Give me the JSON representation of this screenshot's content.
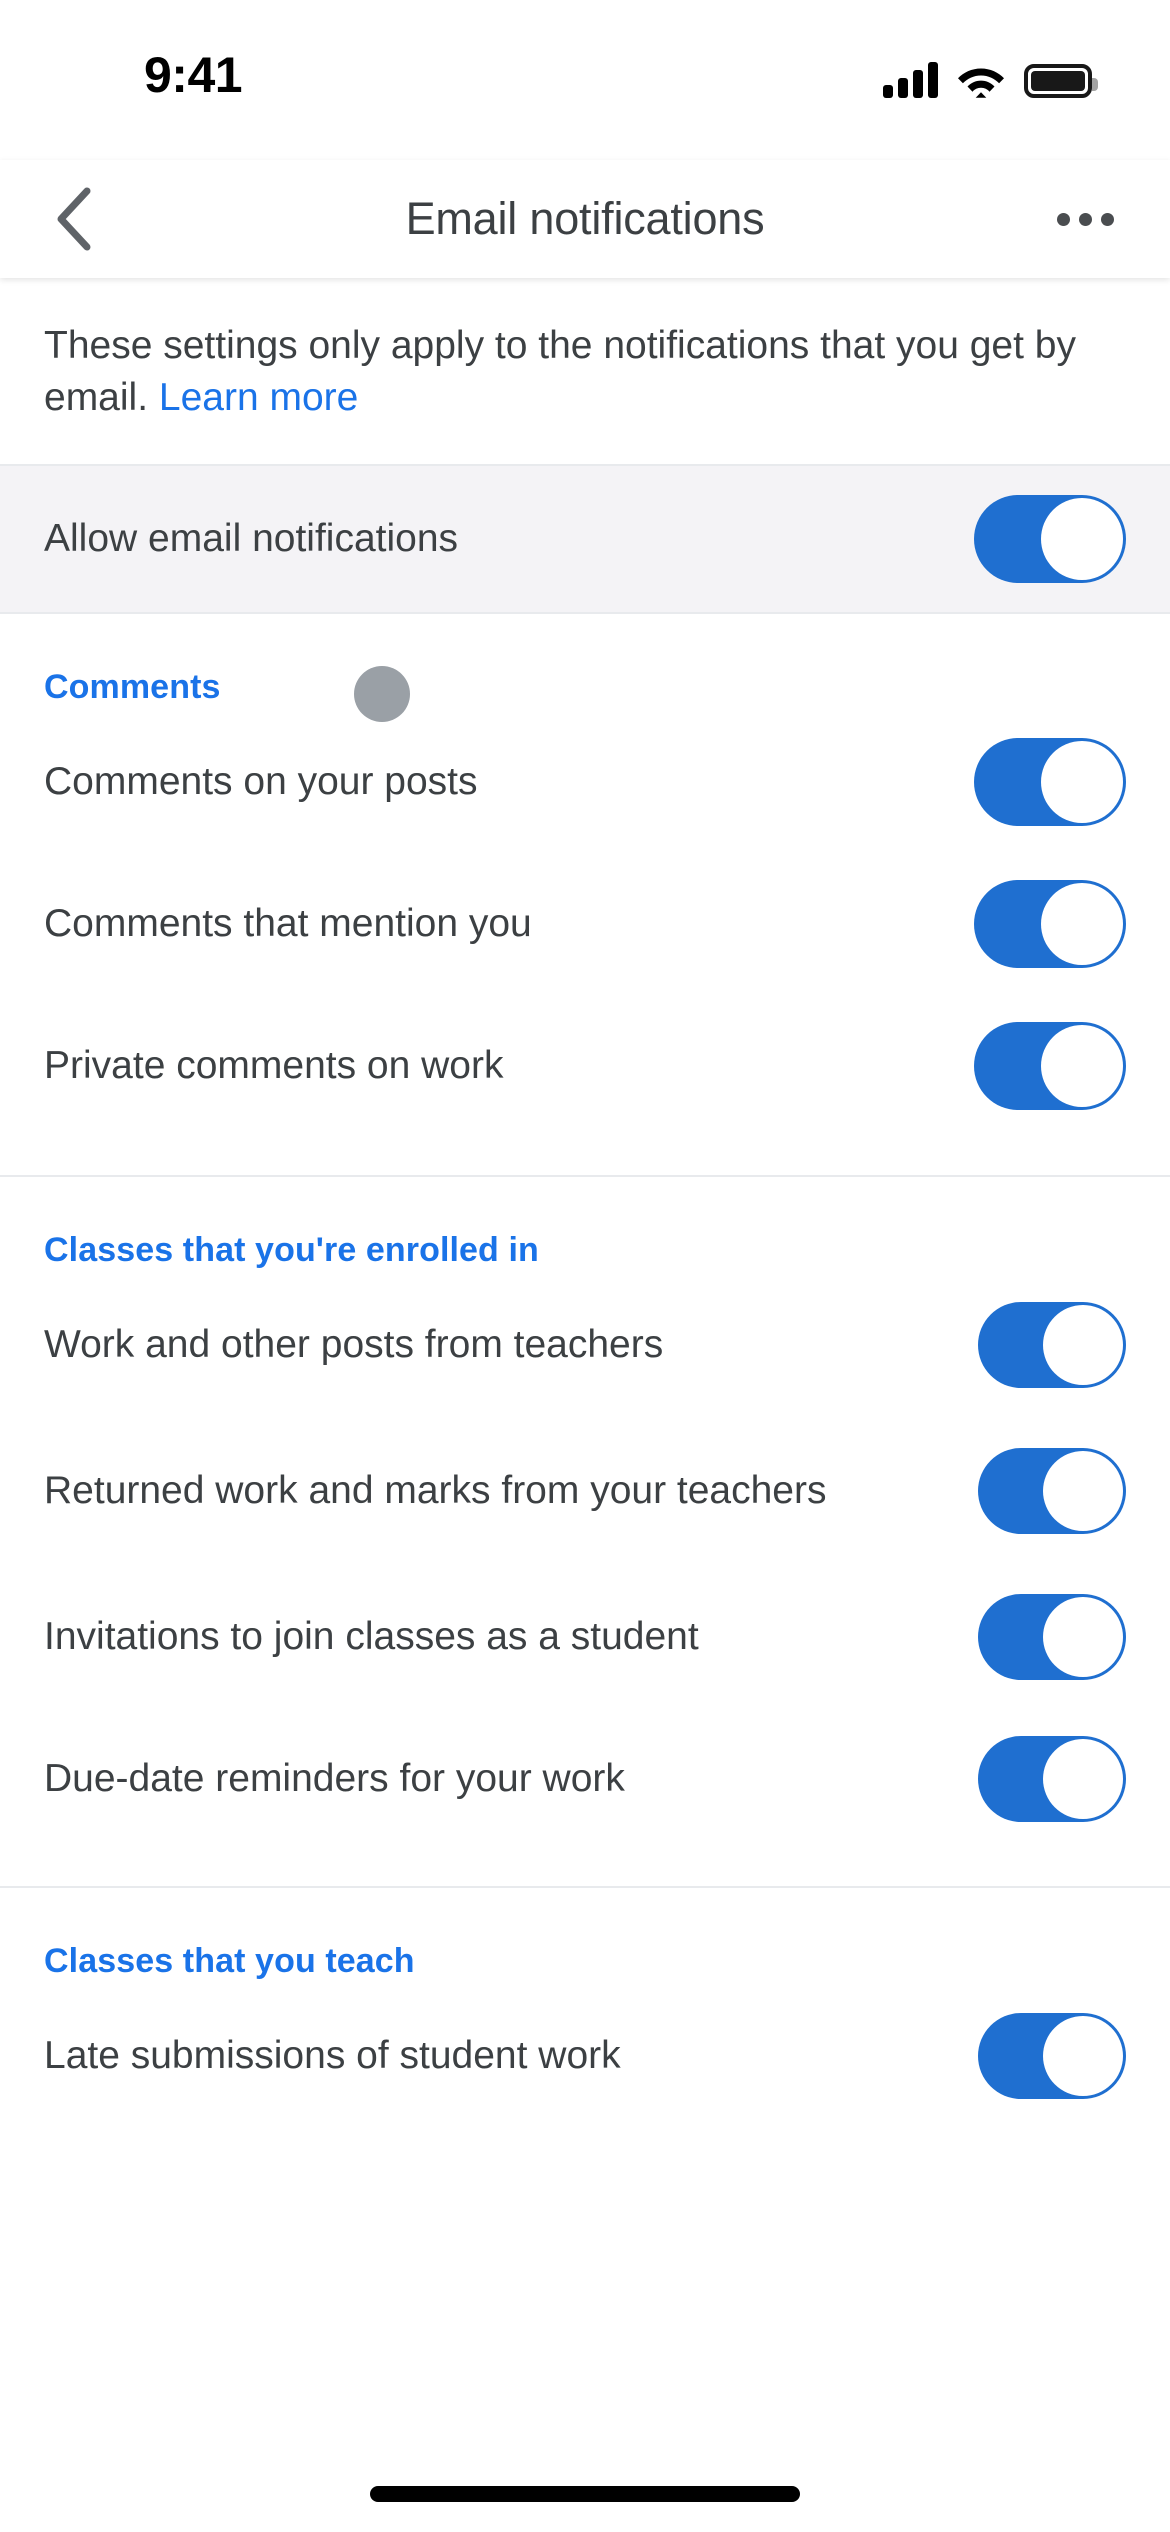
{
  "status_bar": {
    "time": "9:41",
    "cellular_icon": "cellular-signal-icon",
    "wifi_icon": "wifi-icon",
    "battery_icon": "battery-full-icon"
  },
  "app_bar": {
    "back_icon": "back-chevron-icon",
    "title": "Email notifications",
    "overflow_icon": "more-options-icon"
  },
  "intro": {
    "text": "These settings only apply to the notifications that you get by email.",
    "link_label": "Learn more"
  },
  "master_row": {
    "label": "Allow email notifications",
    "toggle_state": "on"
  },
  "sections": [
    {
      "title": "Comments",
      "rows": [
        {
          "label": "Comments on your posts",
          "toggle_state": "on"
        },
        {
          "label": "Comments that mention you",
          "toggle_state": "on"
        },
        {
          "label": "Private comments on work",
          "toggle_state": "on"
        }
      ]
    },
    {
      "title": "Classes that you're enrolled in",
      "rows": [
        {
          "label": "Work and other posts from teachers",
          "toggle_state": "on"
        },
        {
          "label": "Returned work and marks from your teachers",
          "toggle_state": "on"
        },
        {
          "label": "Invitations to join classes as a student",
          "toggle_state": "on"
        },
        {
          "label": "Due-date reminders for your work",
          "toggle_state": "on"
        }
      ]
    },
    {
      "title": "Classes that you teach",
      "rows": [
        {
          "label": "Late submissions of student work",
          "toggle_state": "on"
        }
      ]
    }
  ],
  "touch_indicator": {
    "name": "touch-point-indicator"
  },
  "home_indicator": {
    "name": "home-indicator"
  },
  "colors": {
    "accent_blue": "#1a73e8",
    "toggle_on": "#1f6fd0",
    "text_primary": "#3c4043",
    "divider": "#e8eaed",
    "row_highlight": "#f4f3f6"
  }
}
